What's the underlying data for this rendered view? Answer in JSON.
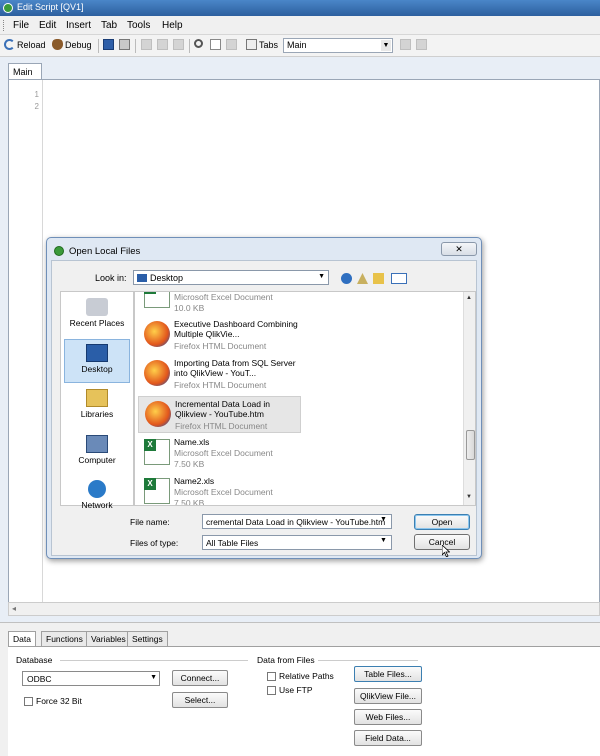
{
  "window": {
    "title": "Edit Script [QV1]"
  },
  "menu": [
    "File",
    "Edit",
    "Insert",
    "Tab",
    "Tools",
    "Help"
  ],
  "toolbar": {
    "reload": "Reload",
    "debug": "Debug",
    "tabs_label": "Tabs",
    "tabs_value": "Main"
  },
  "editor": {
    "tab": "Main",
    "lines": [
      "1",
      "2"
    ]
  },
  "bottom": {
    "tabs": [
      "Data",
      "Functions",
      "Variables",
      "Settings"
    ],
    "database_label": "Database",
    "database_value": "ODBC",
    "connect": "Connect...",
    "select": "Select...",
    "force32": "Force 32 Bit",
    "data_from_files": "Data from Files",
    "relative_paths": "Relative Paths",
    "use_ftp": "Use FTP",
    "table_files": "Table Files...",
    "qlikview_file": "QlikView File...",
    "web_files": "Web Files...",
    "field_data": "Field Data..."
  },
  "dialog": {
    "title": "Open Local Files",
    "look_in_label": "Look in:",
    "look_in_value": "Desktop",
    "places": [
      "Recent Places",
      "Desktop",
      "Libraries",
      "Computer",
      "Network"
    ],
    "files": [
      {
        "name": "",
        "type": "Microsoft Excel Document",
        "size": "10.0 KB",
        "icon": "excel"
      },
      {
        "name": "Executive Dashboard Combining Multiple QlikVie...",
        "type": "Firefox HTML Document",
        "size": "",
        "icon": "firefox"
      },
      {
        "name": "Importing Data from SQL Server into QlikView - YouT...",
        "type": "Firefox HTML Document",
        "size": "",
        "icon": "firefox"
      },
      {
        "name": "Incremental Data Load in Qlikview - YouTube.htm",
        "type": "Firefox HTML Document",
        "size": "",
        "icon": "firefox"
      },
      {
        "name": "Name.xls",
        "type": "Microsoft Excel Document",
        "size": "7.50 KB",
        "icon": "excel"
      },
      {
        "name": "Name2.xls",
        "type": "Microsoft Excel Document",
        "size": "7.50 KB",
        "icon": "excel"
      }
    ],
    "file_name_label": "File name:",
    "file_name_value": "cremental Data Load in Qlikview - YouTube.htm",
    "files_of_type_label": "Files of type:",
    "files_of_type_value": "All Table Files",
    "open": "Open",
    "cancel": "Cancel",
    "close": "✕"
  },
  "colors": {
    "title_bar": "#2c5f9e",
    "selection": "#cde3f7",
    "dialog_frame": "#dfe8f3"
  }
}
